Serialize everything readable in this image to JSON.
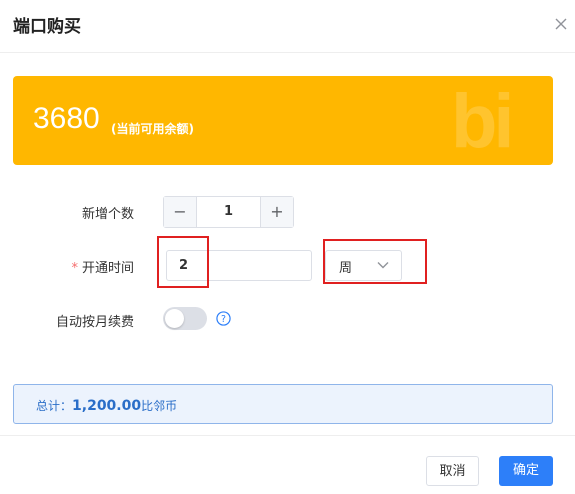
{
  "dialog": {
    "title": "端口购买",
    "close_icon": "close-icon"
  },
  "banner": {
    "balance": "3680",
    "balance_note": "(当前可用余额)",
    "logo_text": "bi",
    "color": "#FFB700"
  },
  "form": {
    "count_label": "新增个数",
    "count_minus": "−",
    "count_value": "1",
    "count_plus": "+",
    "time_label": "开通时间",
    "required_mark": "*",
    "duration_value": "2",
    "unit_value": "周",
    "auto_renew_label": "自动按月续费",
    "auto_renew_on": false,
    "help_icon": "question-circle-icon"
  },
  "summary": {
    "prefix": "总计：",
    "amount": "1,200.00",
    "suffix": "比邻币"
  },
  "footer": {
    "cancel_label": "取消",
    "confirm_label": "确定",
    "accent": "#2d7ff9"
  }
}
